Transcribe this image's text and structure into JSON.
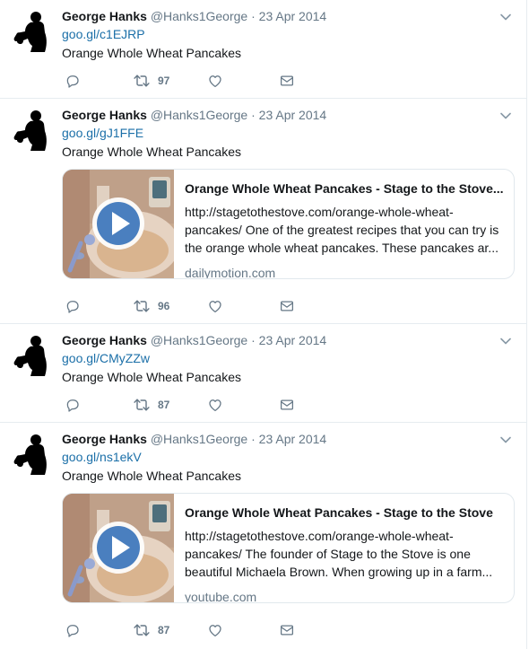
{
  "accent_color": "#1b6fa8",
  "tweets": [
    {
      "name": "George Hanks",
      "handle": "@Hanks1George",
      "separator": "·",
      "date": "23 Apr 2014",
      "link": "goo.gl/c1EJRP",
      "text": "Orange Whole Wheat Pancakes",
      "retweets": "97"
    },
    {
      "name": "George Hanks",
      "handle": "@Hanks1George",
      "separator": "·",
      "date": "23 Apr 2014",
      "link": "goo.gl/gJ1FFE",
      "text": "Orange Whole Wheat Pancakes",
      "retweets": "96",
      "card": {
        "title": "Orange Whole Wheat Pancakes - Stage to the Stove...",
        "description": "http://stagetothestove.com/orange-whole-wheat-pancakes/ One of the greatest recipes that you can try is the orange whole wheat pancakes. These pancakes ar...",
        "domain": "dailymotion.com"
      }
    },
    {
      "name": "George Hanks",
      "handle": "@Hanks1George",
      "separator": "·",
      "date": "23 Apr 2014",
      "link": "goo.gl/CMyZZw",
      "text": "Orange Whole Wheat Pancakes",
      "retweets": "87"
    },
    {
      "name": "George Hanks",
      "handle": "@Hanks1George",
      "separator": "·",
      "date": "23 Apr 2014",
      "link": "goo.gl/ns1ekV",
      "text": "Orange Whole Wheat Pancakes",
      "retweets": "87",
      "card": {
        "title": "Orange Whole Wheat Pancakes - Stage to the Stove",
        "description": "http://stagetothestove.com/orange-whole-wheat-pancakes/ The founder of Stage to the Stove is one beautiful Michaela Brown. When growing up in a farm...",
        "domain": "youtube.com"
      }
    }
  ]
}
